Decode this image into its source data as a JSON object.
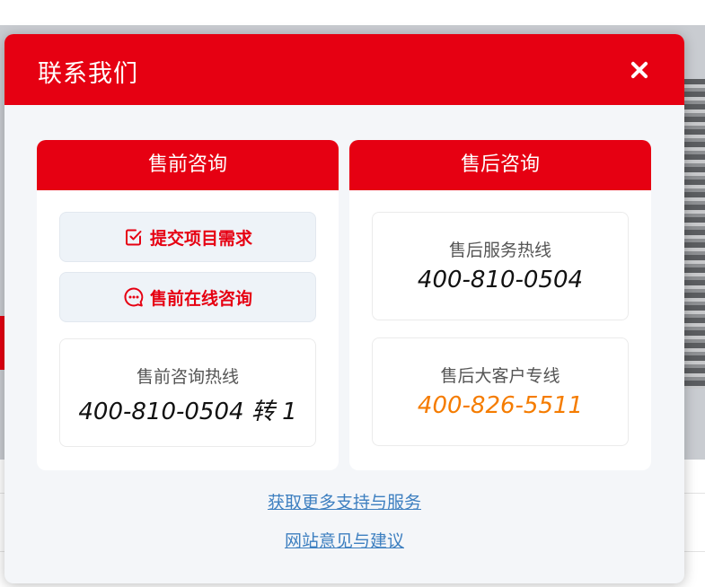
{
  "modal": {
    "title": "联系我们",
    "close_icon": "close-icon"
  },
  "presale": {
    "heading": "售前咨询",
    "submit_button": {
      "label": "提交项目需求",
      "icon": "checklist-icon"
    },
    "chat_button": {
      "label": "售前在线咨询",
      "icon": "chat-bubble-icon"
    },
    "hotline": {
      "label": "售前咨询热线",
      "number": "400-810-0504 转 1"
    }
  },
  "aftersale": {
    "heading": "售后咨询",
    "service_hotline": {
      "label": "售后服务热线",
      "number": "400-810-0504"
    },
    "vip_hotline": {
      "label": "售后大客户专线",
      "number": "400-826-5511"
    }
  },
  "footer": {
    "support_link": "获取更多支持与服务",
    "feedback_link": "网站意见与建议"
  },
  "colors": {
    "brand_red": "#e60012",
    "accent_orange": "#f57c00",
    "link_blue": "#3d7fc0"
  }
}
